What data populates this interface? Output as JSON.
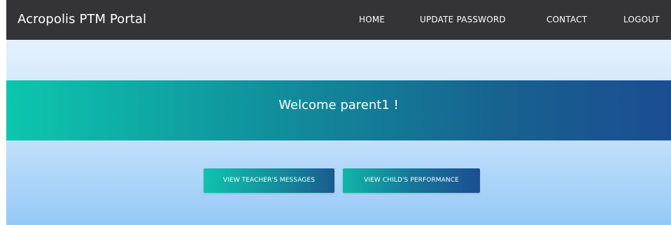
{
  "navbar": {
    "brand": "Acropolis PTM Portal",
    "links": {
      "home": "HOME",
      "update_password": "UPDATE PASSWORD",
      "contact": "CONTACT",
      "logout": "LOGOUT"
    }
  },
  "banner": {
    "welcome": "Welcome parent1 !"
  },
  "actions": {
    "view_messages": "VIEW TEACHER'S MESSAGES",
    "view_performance": "VIEW CHILD'S PERFORMANCE"
  },
  "colors": {
    "navbar_bg": "#343436",
    "banner_start": "#0dc6ad",
    "banner_end": "#1b4d93",
    "page_bg_top": "#e4f1fd",
    "page_bg_bottom": "#95c9f6"
  }
}
